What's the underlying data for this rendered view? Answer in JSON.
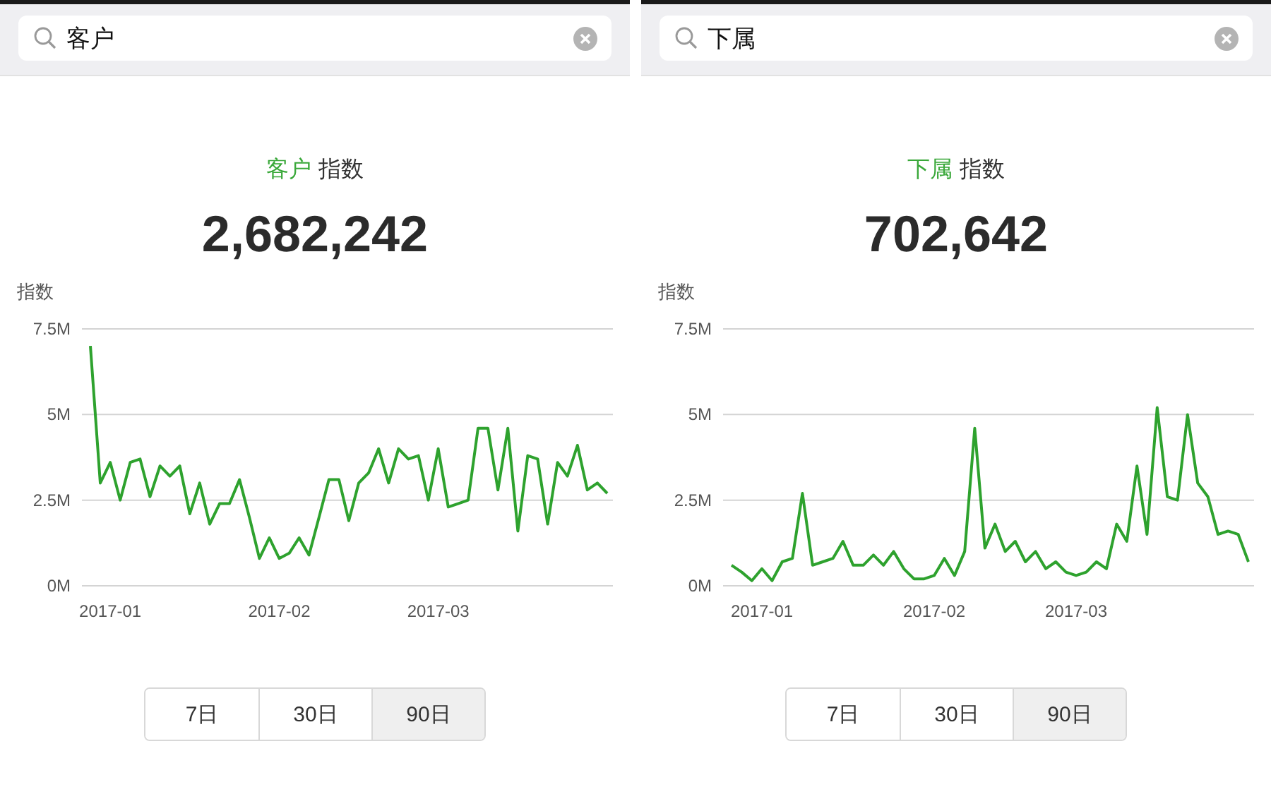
{
  "panels": [
    {
      "search": {
        "value": "客户"
      },
      "title": {
        "keyword": "客户",
        "suffix": "指数"
      },
      "total": "2,682,242",
      "chart_data": {
        "type": "line",
        "ylabel": "指数",
        "ylim": [
          0,
          7.5
        ],
        "yticks": [
          {
            "value": 0,
            "label": "0M"
          },
          {
            "value": 2.5,
            "label": "2.5M"
          },
          {
            "value": 5,
            "label": "5M"
          },
          {
            "value": 7.5,
            "label": "7.5M"
          }
        ],
        "categories": [
          null,
          null,
          "2017-01",
          null,
          null,
          null,
          null,
          null,
          null,
          null,
          null,
          null,
          null,
          null,
          null,
          null,
          null,
          null,
          null,
          "2017-02",
          null,
          null,
          null,
          null,
          null,
          null,
          null,
          null,
          null,
          null,
          null,
          null,
          null,
          null,
          null,
          "2017-03",
          null,
          null,
          null,
          null,
          null,
          null,
          null,
          null,
          null,
          null,
          null,
          null,
          null,
          null,
          null,
          null,
          null
        ],
        "series": [
          {
            "color": "#2ea22e",
            "values": [
              7.0,
              3.0,
              3.6,
              2.5,
              3.6,
              3.7,
              2.6,
              3.5,
              3.2,
              3.5,
              2.1,
              3.0,
              1.8,
              2.4,
              2.4,
              3.1,
              2.0,
              0.8,
              1.4,
              0.8,
              0.95,
              1.4,
              0.9,
              2.0,
              3.1,
              3.1,
              1.9,
              3.0,
              3.3,
              4.0,
              3.0,
              4.0,
              3.7,
              3.8,
              2.5,
              4.0,
              2.3,
              2.4,
              2.5,
              4.6,
              4.6,
              2.8,
              4.6,
              1.6,
              3.8,
              3.7,
              1.8,
              3.6,
              3.2,
              4.1,
              2.8,
              3.0,
              2.7
            ]
          }
        ]
      },
      "ranges": [
        {
          "label": "7日",
          "selected": false
        },
        {
          "label": "30日",
          "selected": false
        },
        {
          "label": "90日",
          "selected": true
        }
      ]
    },
    {
      "search": {
        "value": "下属"
      },
      "title": {
        "keyword": "下属",
        "suffix": "指数"
      },
      "total": "702,642",
      "chart_data": {
        "type": "line",
        "ylabel": "指数",
        "ylim": [
          0,
          7.5
        ],
        "yticks": [
          {
            "value": 0,
            "label": "0M"
          },
          {
            "value": 2.5,
            "label": "2.5M"
          },
          {
            "value": 5,
            "label": "5M"
          },
          {
            "value": 7.5,
            "label": "7.5M"
          }
        ],
        "categories": [
          null,
          null,
          null,
          "2017-01",
          null,
          null,
          null,
          null,
          null,
          null,
          null,
          null,
          null,
          null,
          null,
          null,
          null,
          null,
          null,
          null,
          "2017-02",
          null,
          null,
          null,
          null,
          null,
          null,
          null,
          null,
          null,
          null,
          null,
          null,
          null,
          "2017-03",
          null,
          null,
          null,
          null,
          null,
          null,
          null,
          null,
          null,
          null,
          null,
          null,
          null,
          null,
          null,
          null,
          null
        ],
        "series": [
          {
            "color": "#2ea22e",
            "values": [
              0.6,
              0.4,
              0.15,
              0.5,
              0.15,
              0.7,
              0.8,
              2.7,
              0.6,
              0.7,
              0.8,
              1.3,
              0.6,
              0.6,
              0.9,
              0.6,
              1.0,
              0.5,
              0.2,
              0.2,
              0.3,
              0.8,
              0.3,
              1.0,
              4.6,
              1.1,
              1.8,
              1.0,
              1.3,
              0.7,
              1.0,
              0.5,
              0.7,
              0.4,
              0.3,
              0.4,
              0.7,
              0.5,
              1.8,
              1.3,
              3.5,
              1.5,
              5.2,
              2.6,
              2.5,
              5.0,
              3.0,
              2.6,
              1.5,
              1.6,
              1.5,
              0.7
            ]
          }
        ]
      },
      "ranges": [
        {
          "label": "7日",
          "selected": false
        },
        {
          "label": "30日",
          "selected": false
        },
        {
          "label": "90日",
          "selected": true
        }
      ]
    }
  ]
}
